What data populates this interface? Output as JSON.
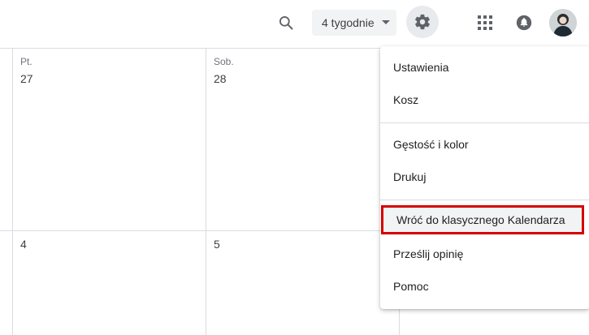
{
  "header": {
    "view_select": {
      "label": "4 tygodnie"
    }
  },
  "calendar": {
    "days": [
      {
        "name": "Pt.",
        "number": "27"
      },
      {
        "name": "Sob.",
        "number": "28"
      }
    ],
    "week2": [
      {
        "number": "4"
      },
      {
        "number": "5"
      }
    ]
  },
  "settings_menu": {
    "items": [
      {
        "label": "Ustawienia"
      },
      {
        "label": "Kosz"
      },
      {
        "label": "Gęstość i kolor"
      },
      {
        "label": "Drukuj"
      },
      {
        "label": "Wróć do klasycznego Kalendarza",
        "highlighted": true
      },
      {
        "label": "Prześlij opinię"
      },
      {
        "label": "Pomoc"
      }
    ],
    "highlight_color": "#d50000"
  },
  "colors": {
    "accent_icon": "#5f6368",
    "border": "#dadce0"
  },
  "icons": [
    "search-icon",
    "gear-icon",
    "apps-grid-icon",
    "notifications-bell-icon",
    "avatar"
  ]
}
